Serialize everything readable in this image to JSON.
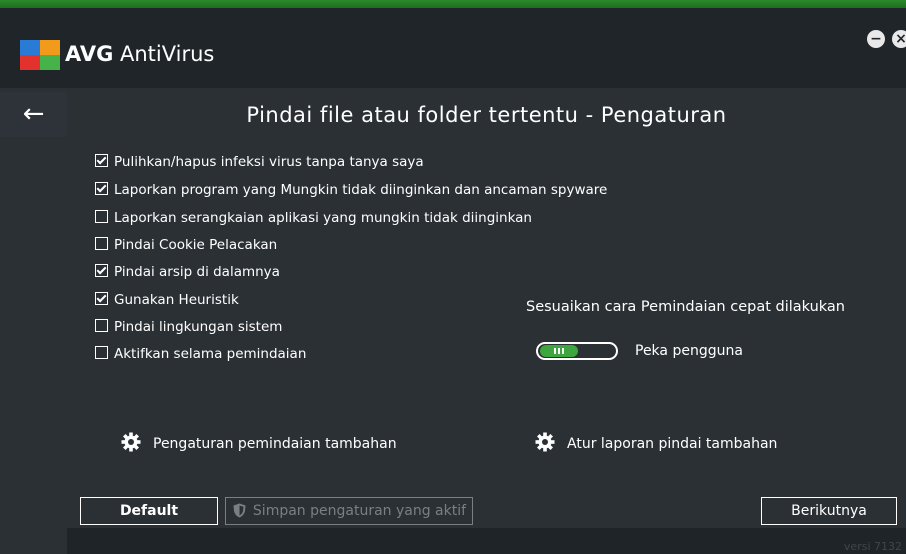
{
  "app": {
    "brand_bold": "AVG",
    "brand_rest": " AntiVirus"
  },
  "window_controls": {
    "minimize": "−",
    "close": "×"
  },
  "page": {
    "back_icon": "←",
    "title": "Pindai file atau folder tertentu - Pengaturan"
  },
  "options": [
    {
      "label": "Pulihkan/hapus infeksi virus tanpa tanya saya",
      "checked": true
    },
    {
      "label": "Laporkan program yang Mungkin tidak diinginkan dan ancaman spyware",
      "checked": true
    },
    {
      "label": "Laporkan serangkaian aplikasi yang mungkin tidak diinginkan",
      "checked": false
    },
    {
      "label": "Pindai Cookie Pelacakan",
      "checked": false
    },
    {
      "label": "Pindai arsip di dalamnya",
      "checked": true
    },
    {
      "label": "Gunakan Heuristik",
      "checked": true
    },
    {
      "label": "Pindai lingkungan sistem",
      "checked": false
    },
    {
      "label": "Aktifkan selama pemindaian",
      "checked": false
    }
  ],
  "quick_scan": {
    "title": "Sesuaikan cara Pemindaian cepat dilakukan",
    "toggle_label": "Peka pengguna",
    "toggle_color": "#3ea63e"
  },
  "links": {
    "additional_settings": "Pengaturan pemindaian tambahan",
    "additional_reports": "Atur laporan pindai tambahan"
  },
  "buttons": {
    "default": "Default",
    "save": "Simpan pengaturan yang aktif",
    "next": "Berikutnya"
  },
  "footer": {
    "version": "versi 7132"
  }
}
